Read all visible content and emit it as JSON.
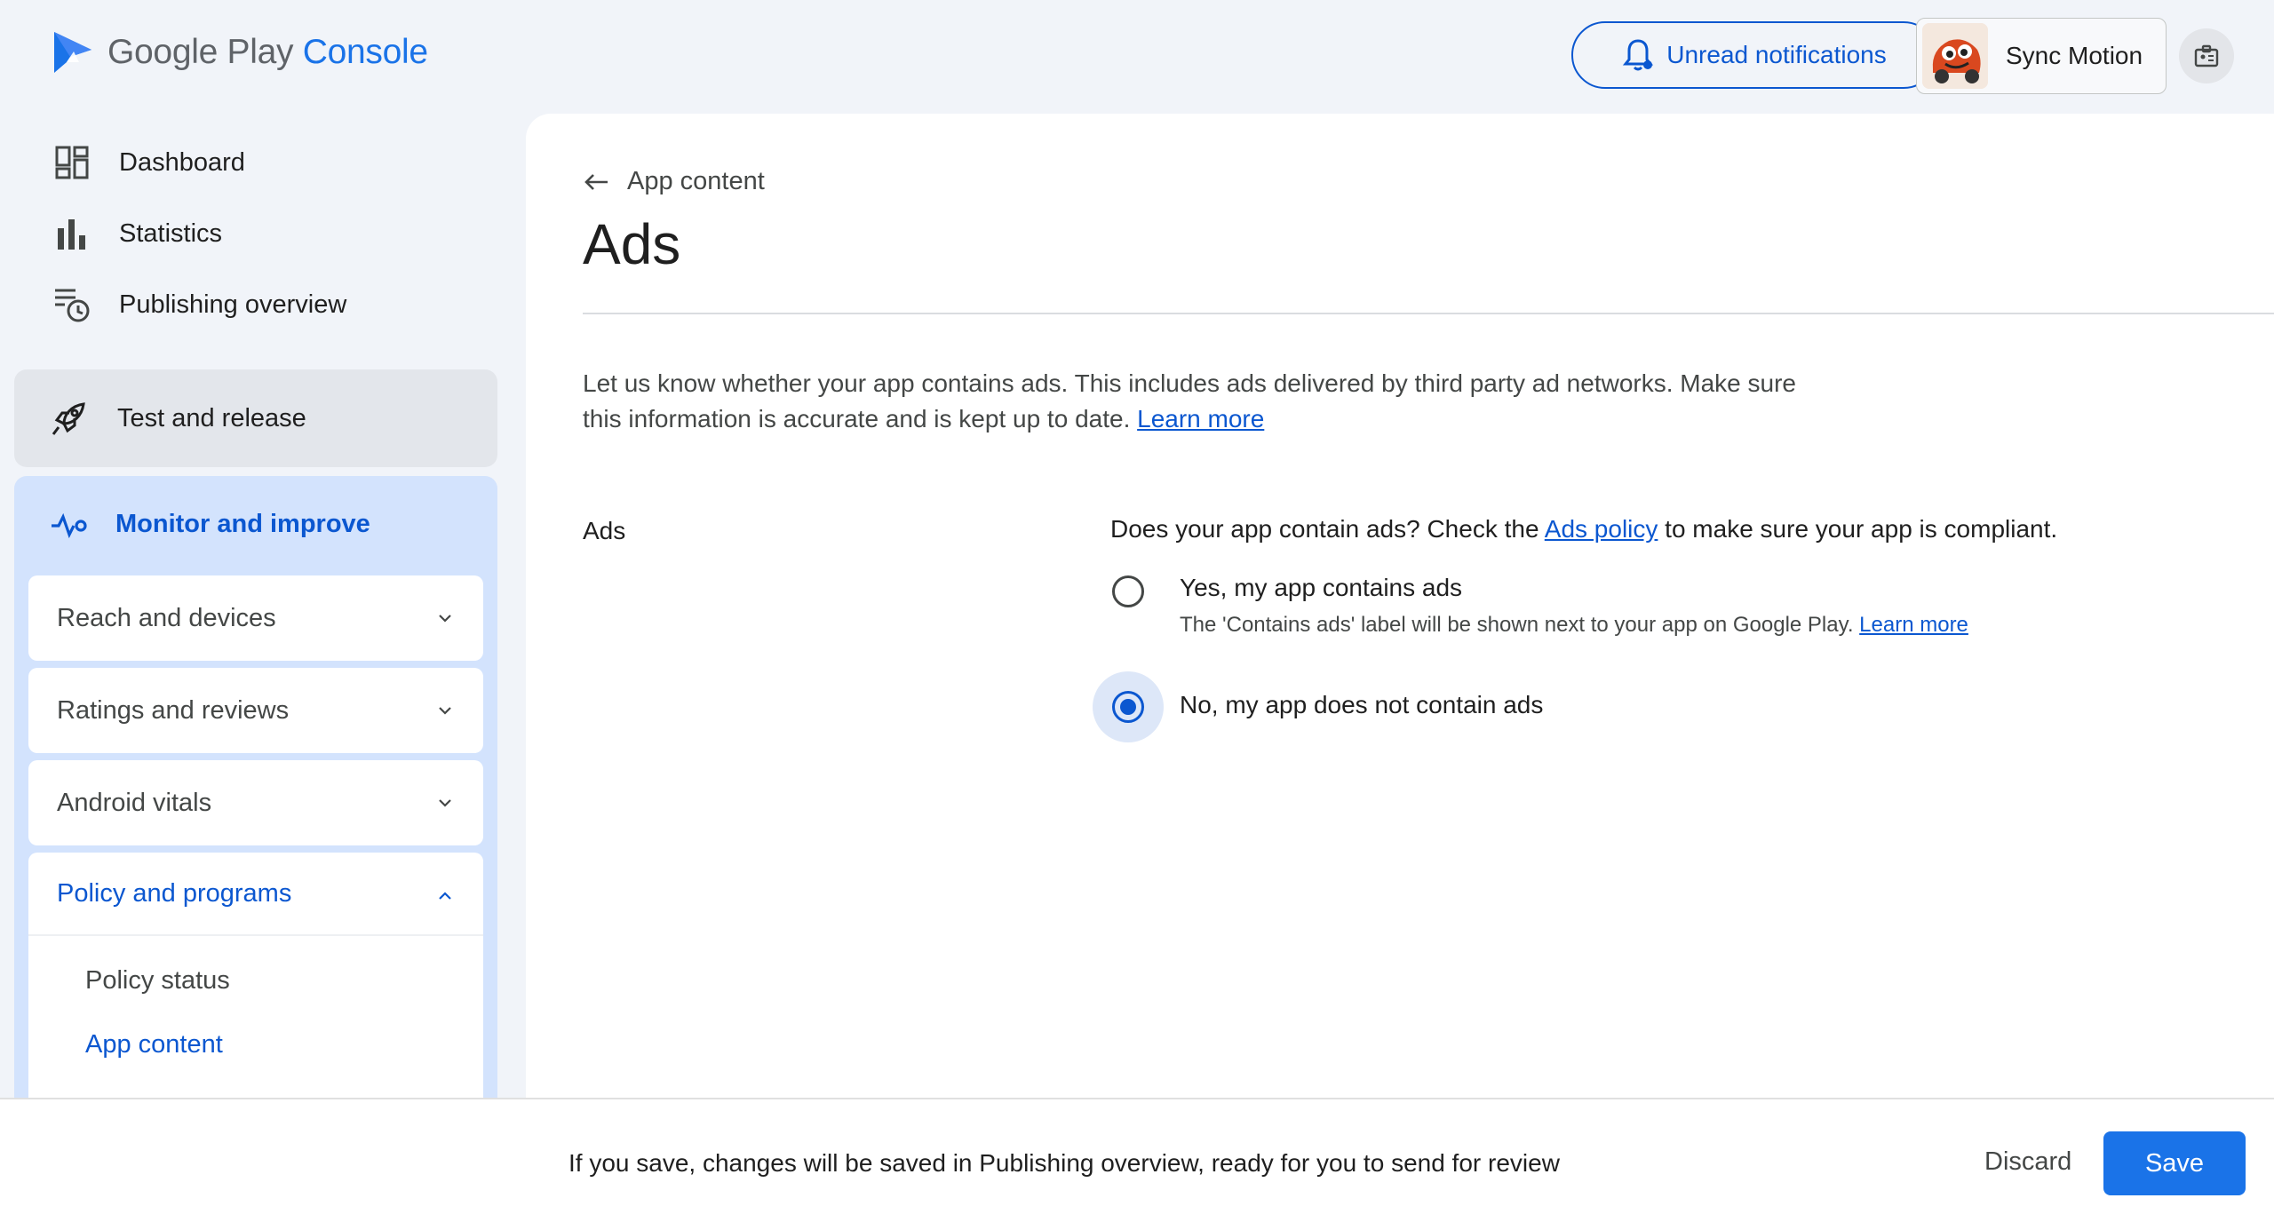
{
  "brand": {
    "google_play": "Google Play",
    "console": "Console"
  },
  "header": {
    "notifications_label": "Unread notifications",
    "account_name": "Sync Motion"
  },
  "sidebar": {
    "top_items": [
      {
        "label": "Dashboard",
        "icon": "dashboard-icon"
      },
      {
        "label": "Statistics",
        "icon": "bar-chart-icon"
      },
      {
        "label": "Publishing overview",
        "icon": "publishing-clock-icon"
      }
    ],
    "test_and_release": "Test and release",
    "monitor_and_improve": "Monitor and improve",
    "sections": [
      {
        "label": "Reach and devices",
        "expanded": false
      },
      {
        "label": "Ratings and reviews",
        "expanded": false
      },
      {
        "label": "Android vitals",
        "expanded": false
      },
      {
        "label": "Policy and programs",
        "expanded": true
      }
    ],
    "policy_items": [
      {
        "label": "Policy status",
        "active": false
      },
      {
        "label": "App content",
        "active": true
      }
    ]
  },
  "main": {
    "back_label": "App content",
    "title": "Ads",
    "description": "Let us know whether your app contains ads. This includes ads delivered by third party ad networks. Make sure this information is accurate and is kept up to date.",
    "learn_more": "Learn more",
    "section_label": "Ads",
    "question_prefix": "Does your app contain ads? Check the",
    "question_link": "Ads policy",
    "question_suffix": "to make sure your app is compliant.",
    "options": [
      {
        "label": "Yes, my app contains ads",
        "hint": "The 'Contains ads' label will be shown next to your app on Google Play.",
        "hint_link": "Learn more",
        "selected": false
      },
      {
        "label": "No, my app does not contain ads",
        "selected": true
      }
    ]
  },
  "footer": {
    "message": "If you save, changes will be saved in Publishing overview, ready for you to send for review",
    "discard_label": "Discard",
    "save_label": "Save"
  },
  "colors": {
    "accent": "#0b57d0",
    "save_button": "#1a73e8",
    "nav_highlight": "#d3e3fd"
  }
}
